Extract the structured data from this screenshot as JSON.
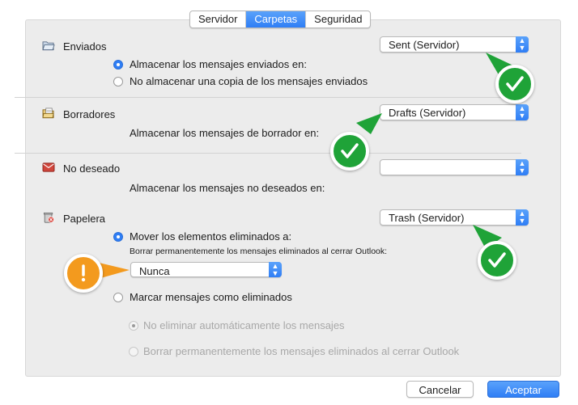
{
  "tabs": [
    {
      "label": "Servidor"
    },
    {
      "label": "Carpetas"
    },
    {
      "label": "Seguridad"
    }
  ],
  "sent": {
    "label": "Enviados",
    "popup_value": "Sent (Servidor)",
    "option_store": "Almacenar los mensajes enviados en:",
    "option_no_store": "No almacenar una copia de los mensajes enviados"
  },
  "drafts": {
    "label": "Borradores",
    "popup_value": "Drafts (Servidor)",
    "store_text": "Almacenar los mensajes de borrador en:"
  },
  "junk": {
    "label": "No deseado",
    "popup_value": "",
    "store_text": "Almacenar los mensajes no deseados en:"
  },
  "trash": {
    "label": "Papelera",
    "popup_value": "Trash (Servidor)",
    "option_move": "Mover los elementos eliminados a:",
    "purge_label": "Borrar permanentemente los mensajes eliminados al cerrar Outlook:",
    "purge_value": "Nunca",
    "option_mark": "Marcar mensajes como eliminados",
    "sub_option_keep": "No eliminar automáticamente los mensajes",
    "sub_option_purge": "Borrar permanentemente los mensajes eliminados al cerrar Outlook"
  },
  "buttons": {
    "cancel": "Cancelar",
    "accept": "Aceptar"
  },
  "colors": {
    "accent": "#2f7ef5",
    "check_badge": "#1fa338",
    "warning_badge": "#f39a1e"
  },
  "icons": [
    "sent-folder-icon",
    "drafts-folder-icon",
    "junk-mail-icon",
    "trash-icon",
    "checkmark-icon",
    "exclamation-icon"
  ]
}
